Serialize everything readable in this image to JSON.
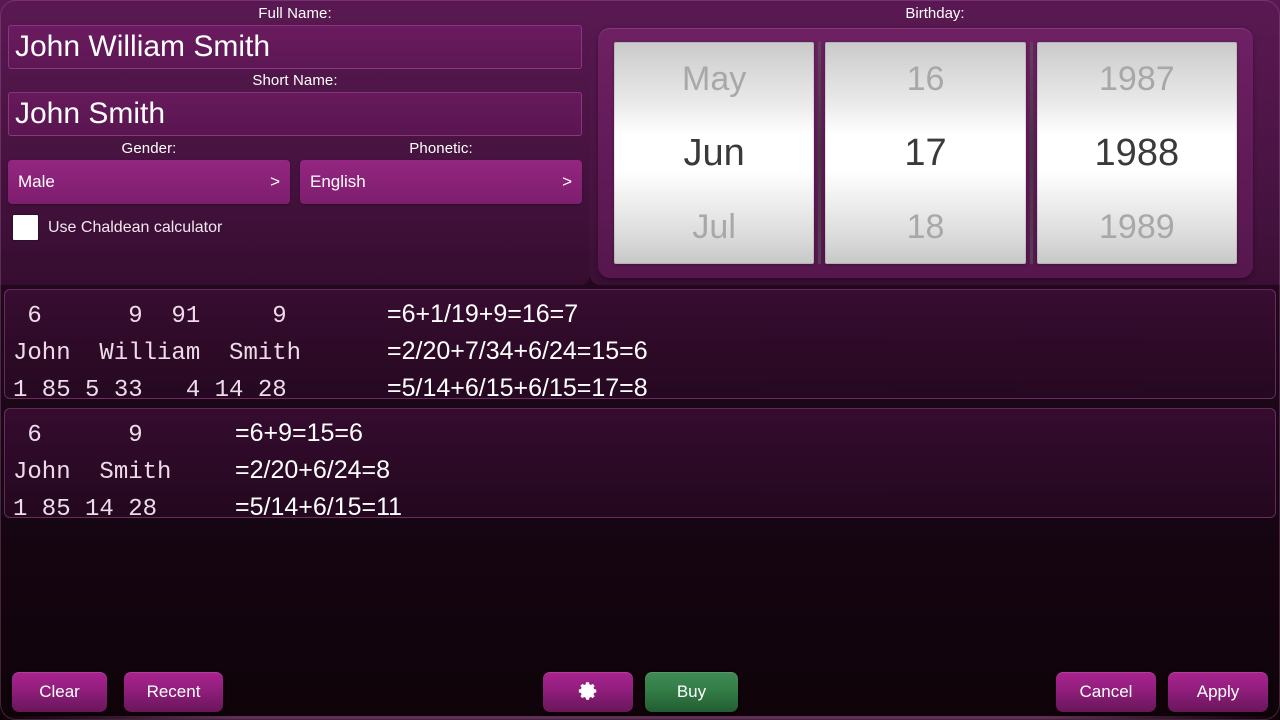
{
  "form": {
    "full_name_label": "Full Name:",
    "full_name_value": "John William Smith",
    "short_name_label": "Short Name:",
    "short_name_value": "John Smith",
    "gender_label": "Gender:",
    "gender_value": "Male",
    "gender_arrow": ">",
    "phonetic_label": "Phonetic:",
    "phonetic_value": "English",
    "phonetic_arrow": ">",
    "chaldean_label": "Use Chaldean calculator",
    "chaldean_checked": false
  },
  "birthday": {
    "label": "Birthday:",
    "month": {
      "prev": "May",
      "selected": "Jun",
      "next": "Jul"
    },
    "day": {
      "prev": "16",
      "selected": "17",
      "next": "18"
    },
    "year": {
      "prev": "1987",
      "selected": "1988",
      "next": "1989"
    }
  },
  "results": {
    "panel_full": {
      "rows": [
        {
          "mono": " 6      9  91     9",
          "eq": "=6+1/19+9=16=7"
        },
        {
          "mono": "John  William  Smith",
          "eq": "=2/20+7/34+6/24=15=6"
        },
        {
          "mono": "1 85 5 33   4 14 28",
          "eq": "=5/14+6/15+6/15=17=8"
        }
      ]
    },
    "panel_short": {
      "rows": [
        {
          "mono": " 6      9",
          "eq": "=6+9=15=6"
        },
        {
          "mono": "John  Smith",
          "eq": "=2/20+6/24=8"
        },
        {
          "mono": "1 85 14 28",
          "eq": "=5/14+6/15=11"
        }
      ]
    }
  },
  "buttons": {
    "clear": "Clear",
    "recent": "Recent",
    "settings": "",
    "buy": "Buy",
    "cancel": "Cancel",
    "apply": "Apply"
  },
  "colors": {
    "accent_magenta": "#951f80",
    "panel_purple": "#5a1852",
    "background_dark": "#150511",
    "buy_green": "#358049",
    "wheel_white": "#ffffff",
    "wheel_dim_text": "#a8a8a8"
  }
}
